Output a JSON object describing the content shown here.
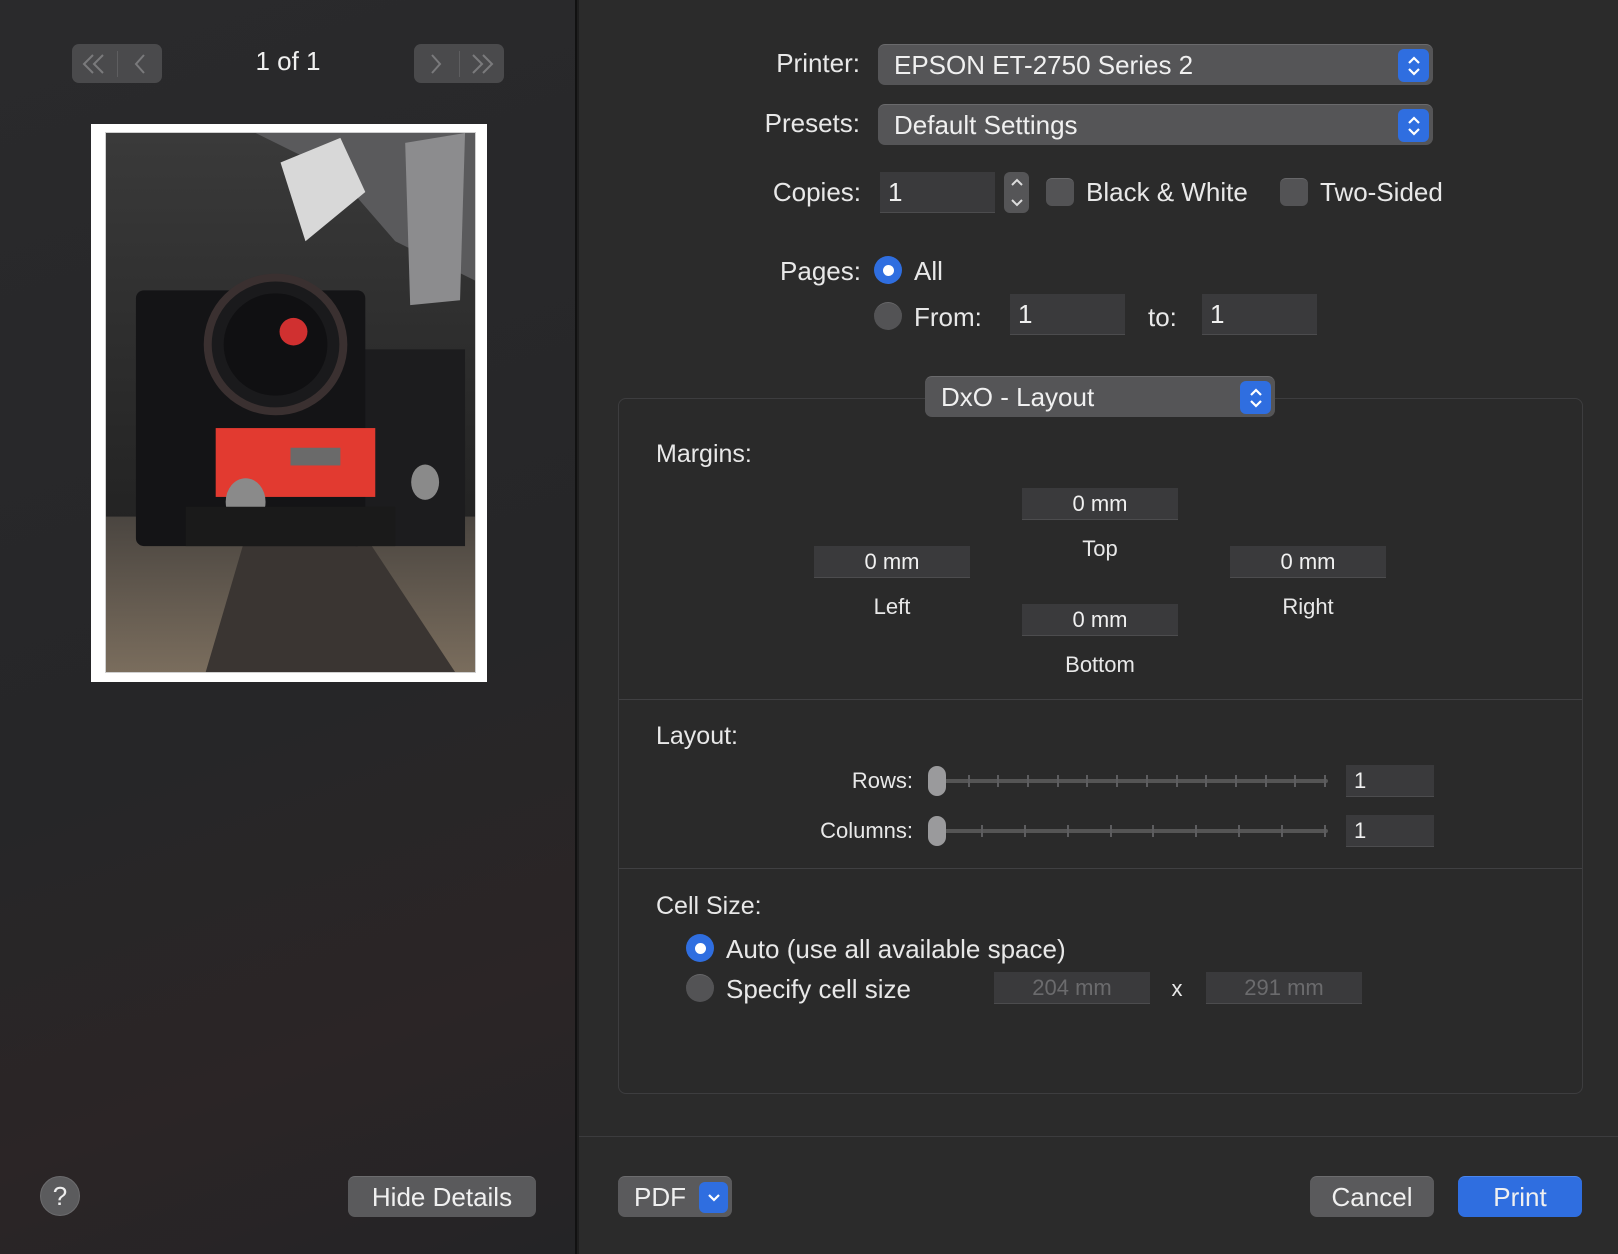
{
  "preview": {
    "page_counter": "1 of 1",
    "first_page_icon": "double-chevron-left-icon",
    "prev_page_icon": "chevron-left-icon",
    "next_page_icon": "chevron-right-icon",
    "last_page_icon": "double-chevron-right-icon",
    "help_label": "?",
    "hide_details_label": "Hide Details"
  },
  "printer": {
    "label": "Printer:",
    "value": "EPSON ET-2750 Series 2"
  },
  "presets": {
    "label": "Presets:",
    "value": "Default Settings"
  },
  "copies": {
    "label": "Copies:",
    "value": "1",
    "black_white_label": "Black & White",
    "black_white_checked": false,
    "two_sided_label": "Two-Sided",
    "two_sided_checked": false
  },
  "pages": {
    "label": "Pages:",
    "all_label": "All",
    "from_label": "From:",
    "from_value": "1",
    "to_label": "to:",
    "to_value": "1",
    "selected": "All"
  },
  "panel_popup": {
    "value": "DxO - Layout"
  },
  "margins": {
    "title": "Margins:",
    "top": {
      "value": "0 mm",
      "label": "Top"
    },
    "left": {
      "value": "0 mm",
      "label": "Left"
    },
    "right": {
      "value": "0 mm",
      "label": "Right"
    },
    "bottom": {
      "value": "0 mm",
      "label": "Bottom"
    }
  },
  "layout": {
    "title": "Layout:",
    "rows_label": "Rows:",
    "rows_value": "1",
    "columns_label": "Columns:",
    "columns_value": "1"
  },
  "cell_size": {
    "title": "Cell Size:",
    "auto_label": "Auto (use all available space)",
    "specify_label": "Specify cell size",
    "width_value": "204 mm",
    "times": "x",
    "height_value": "291 mm",
    "selected": "auto"
  },
  "footer": {
    "pdf_label": "PDF",
    "cancel_label": "Cancel",
    "print_label": "Print"
  },
  "colors": {
    "accent": "#2f6ee0",
    "window_bg": "#2b2b2b",
    "sidebar_bg": "#262628"
  }
}
